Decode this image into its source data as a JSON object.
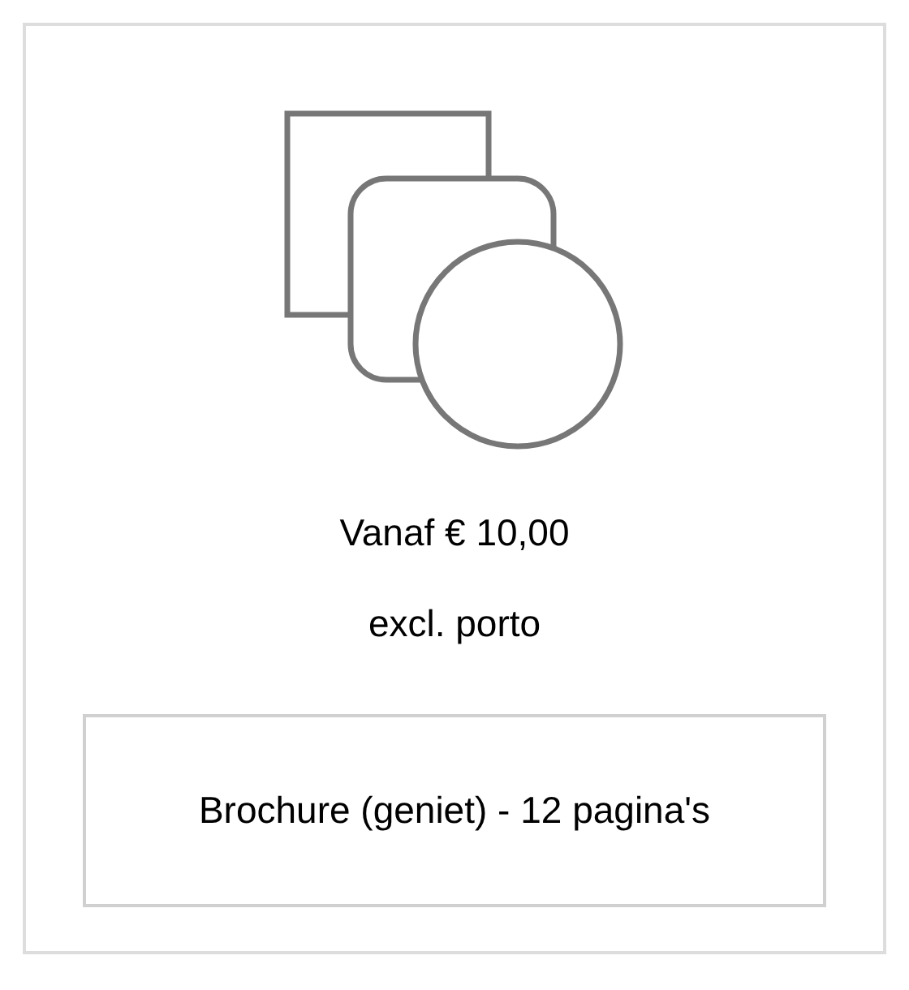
{
  "price": "Vanaf € 10,00",
  "note": "excl. porto",
  "option": {
    "label": "Brochure (geniet) - 12 pagina's"
  }
}
